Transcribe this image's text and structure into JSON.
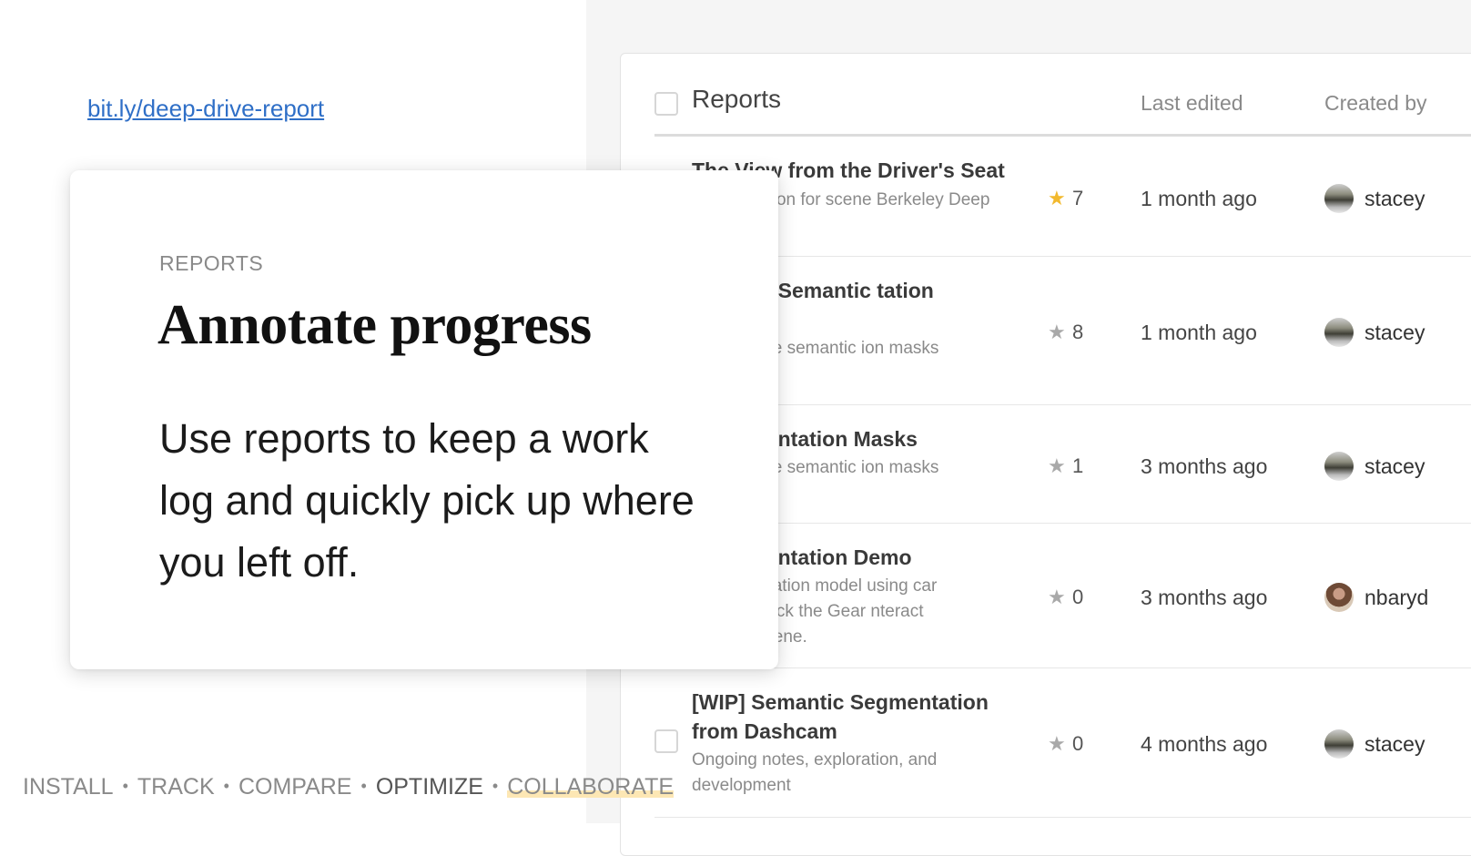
{
  "link": "bit.ly/deep-drive-report",
  "card": {
    "eyebrow": "REPORTS",
    "headline": "Annotate progress",
    "body": "Use reports to keep a work log and quickly pick up where you left off."
  },
  "reports": {
    "header": {
      "title": "Reports",
      "col_edited": "Last edited",
      "col_created": "Created by"
    },
    "rows": [
      {
        "title": "The View from the Driver's Seat",
        "desc": "segmentation for scene Berkeley Deep Drive 100K",
        "stars": "7",
        "starred": true,
        "edited": "1 month ago",
        "user": "stacey"
      },
      {
        "title": "asks for Semantic tation",
        "desc": "and explore semantic ion masks",
        "stars": "8",
        "starred": false,
        "edited": "1 month ago",
        "user": "stacey"
      },
      {
        "title": "c Segmentation Masks",
        "desc": "and explore semantic ion masks",
        "stars": "1",
        "starred": false,
        "edited": "3 months ago",
        "user": "stacey"
      },
      {
        "title": "c Segmentation Demo",
        "desc": "e segmentation model using car scenes. Click the Gear nteract with the scene.",
        "stars": "0",
        "starred": false,
        "edited": "3 months ago",
        "user": "nbaryd"
      },
      {
        "title": "[WIP] Semantic Segmentation from Dashcam",
        "desc": "Ongoing notes, exploration, and development",
        "stars": "0",
        "starred": false,
        "edited": "4 months ago",
        "user": "stacey"
      }
    ]
  },
  "footer": {
    "items": [
      "INSTALL",
      "TRACK",
      "COMPARE",
      "OPTIMIZE",
      "COLLABORATE"
    ],
    "separator": "•"
  },
  "colors": {
    "link": "#2f6fc7",
    "star_active": "#f2b92e",
    "highlight": "#fde7b4"
  },
  "icons": {
    "star": "star-icon",
    "avatar": "user-avatar"
  }
}
